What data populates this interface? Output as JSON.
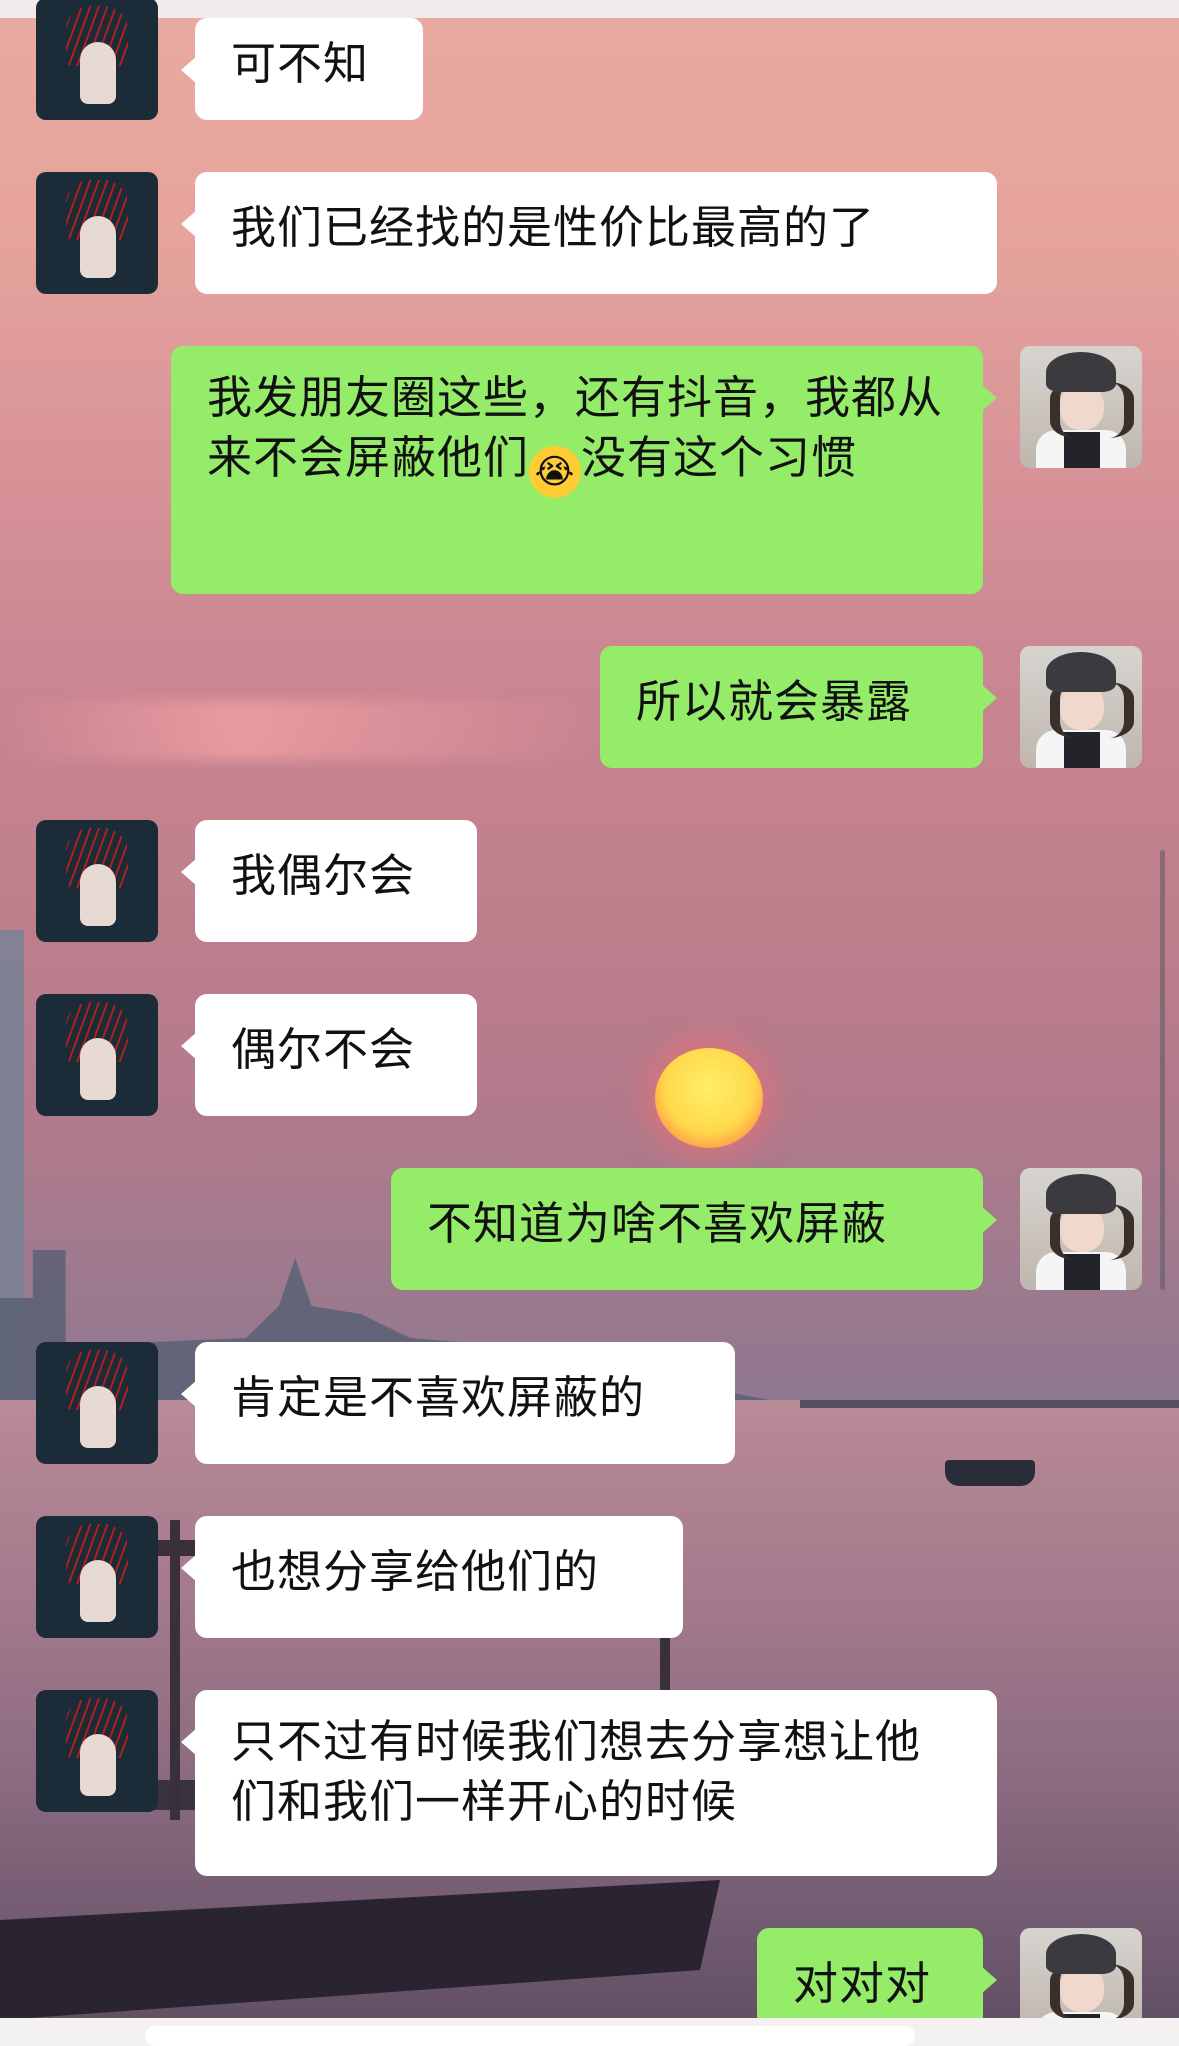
{
  "chat": {
    "messages": [
      {
        "side": "in",
        "text": "可不知"
      },
      {
        "side": "in",
        "text": "我们已经找的是性价比最高的了"
      },
      {
        "side": "out",
        "text_parts": [
          "我发朋友圈这些，还有抖音，我都从来不会屏蔽他们",
          "没有这个习惯"
        ],
        "emoji": "😭"
      },
      {
        "side": "out",
        "text": "所以就会暴露"
      },
      {
        "side": "in",
        "text": "我偶尔会"
      },
      {
        "side": "in",
        "text": "偶尔不会"
      },
      {
        "side": "out",
        "text": "不知道为啥不喜欢屏蔽"
      },
      {
        "side": "in",
        "text": "肯定是不喜欢屏蔽的"
      },
      {
        "side": "in",
        "text": "也想分享给他们的"
      },
      {
        "side": "in",
        "text": "只不过有时候我们想去分享想让他们和我们一样开心的时候"
      },
      {
        "side": "out",
        "text": "对对对"
      }
    ]
  },
  "colors": {
    "incoming_bubble": "#ffffff",
    "outgoing_bubble": "#95ec69"
  },
  "icons": {
    "contact_avatar": "contact-avatar",
    "self_avatar": "self-avatar",
    "emoji": "crying-laughing-emoji"
  }
}
